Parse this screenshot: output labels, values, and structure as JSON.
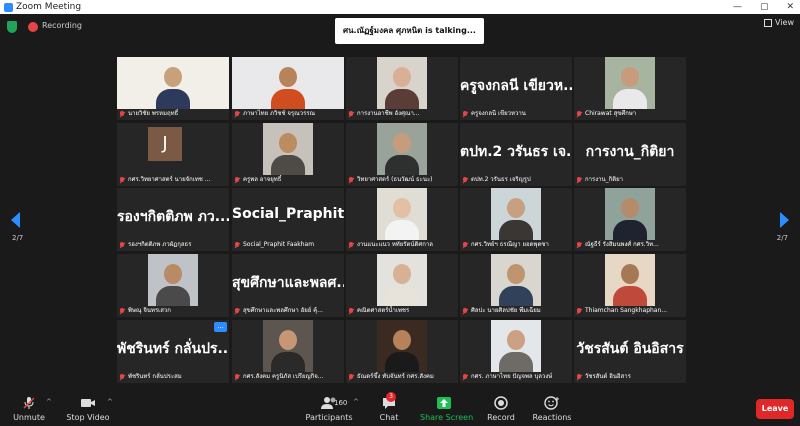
{
  "window": {
    "title": "Zoom Meeting"
  },
  "top": {
    "recording_label": "Recording",
    "talking_text": "ศน.ณัฏฐ์มงคล ศุภหนิต is  talking...",
    "view_label": "View"
  },
  "nav": {
    "page_left": "2/7",
    "page_right": "2/7"
  },
  "tiles": [
    {
      "name": "นายวิชัย  พรหมฤทธิ์",
      "video": true,
      "bg": "#f2efe8",
      "skin": "#c8a07c",
      "shirt": "#2d3a5c"
    },
    {
      "name": "ภาษาไทย ภวิชช์ จรุณวรรณ",
      "video": true,
      "bg": "#e9e9ec",
      "skin": "#b9835a",
      "shirt": "#cf4d1e"
    },
    {
      "name": "การงานอาชีพ อังศุณา...",
      "video": true,
      "bg": "#d8d3cb",
      "skin": "#d9b097",
      "shirt": "#5a3d37"
    },
    {
      "name": "ครูจงกลนี  เขียวหวาน",
      "big": "ครูจงกลนี  เขียวห...",
      "video": false
    },
    {
      "name": "Chirawat สุขศึกษา",
      "video": true,
      "bg": "#a7b4a0",
      "skin": "#c79b7b",
      "shirt": "#e9e9e9"
    },
    {
      "name": "กศร.วิทยาศาสตร์ นายจักเทช ...",
      "video": false,
      "avatar": "J"
    },
    {
      "name": "ครูพล  อาจยุทธิ์",
      "video": true,
      "bg": "#c6c1bb",
      "skin": "#bb8b62",
      "shirt": "#4e4b46"
    },
    {
      "name": "วิทยาศาสตร์ (ธนวัฒน์ ธะนะ)",
      "video": true,
      "bg": "#9aa39a",
      "skin": "#c69d7c",
      "shirt": "#2e2f2f"
    },
    {
      "name": "ตปท.2  วรันธร  เจริญรูป",
      "big": "ตปท.2 วรันธร เจ...",
      "video": false
    },
    {
      "name": "การงาน_กิติยา",
      "big": "การงาน_กิติยา",
      "video": false
    },
    {
      "name": "รองฯกิตติภพ  ภวผัฏกุลธร",
      "big": "รองฯกิตติภพ ภว...",
      "video": false
    },
    {
      "name": "Social_Praphit  Faakham",
      "big": "Social_Praphit F...",
      "video": false
    },
    {
      "name": "งานแนะแนว หทัยรัตน์ดิศกาล",
      "video": true,
      "bg": "#e0ddd5",
      "skin": "#e2bfa5",
      "shirt": "#f3f3f3"
    },
    {
      "name": "กศร.วิทย์ฯ  ธรณีญา ยอดพุดซา",
      "video": true,
      "bg": "#ccd6d8",
      "skin": "#c6a080",
      "shirt": "#3a3634"
    },
    {
      "name": "ณัฐธีร์  รังสิมนพงศ์   กศร.วิท...",
      "video": true,
      "bg": "#8fa39b",
      "skin": "#b48c6c",
      "shirt": "#1f2330"
    },
    {
      "name": "พิษณุ จินทรเสวก",
      "video": true,
      "bg": "#bfc3c7",
      "skin": "#b98a66",
      "shirt": "#4a4a4a"
    },
    {
      "name": "สุขศึกษาและพลศึกษา อัยย์ คุ้...",
      "big": "สุขศึกษาและพลศ...",
      "video": false
    },
    {
      "name": "คณิตศาสตร์น้ำเพชร",
      "video": true,
      "bg": "#e4e2dc",
      "skin": "#d7b096",
      "shirt": "#e7e2da"
    },
    {
      "name": "ศิลปะ นายศิลปชัย พึ่มเฉียม",
      "video": true,
      "bg": "#d9d6cf",
      "skin": "#c0946f",
      "shirt": "#32415a"
    },
    {
      "name": "Thiamchan Sangkhaphan...",
      "video": true,
      "bg": "#e6d8c4",
      "skin": "#a77856",
      "shirt": "#c04a3a"
    },
    {
      "name": "พัชรินทร์ กลั่นประสม",
      "big": "พัชรินทร์ กลั่นปร...",
      "video": false,
      "more": "..."
    },
    {
      "name": "กศร.สังคม ครูนิภัส เปรียญกิจ...",
      "video": true,
      "bg": "#5d5550",
      "skin": "#c79775",
      "shirt": "#2a2a2a"
    },
    {
      "name": "ธัณดร์ขึ้ง ทับจันทร์ กศร.สังคม",
      "video": true,
      "bg": "#3a2a22",
      "skin": "#b5825a",
      "shirt": "#1a1a1a"
    },
    {
      "name": "กศร. ภาษาไทย ปัญจพล บุลวงษ์",
      "video": true,
      "bg": "#e4e7ea",
      "skin": "#cba083",
      "shirt": "#6e6a66"
    },
    {
      "name": "วัชรสันต์ อินอิสาร",
      "big": "วัชรสันต์ อินอิสาร",
      "video": false
    }
  ],
  "toolbar": {
    "unmute": "Unmute",
    "stop_video": "Stop Video",
    "participants": "Participants",
    "participants_count": "160",
    "chat": "Chat",
    "chat_badge": "3",
    "share": "Share Screen",
    "record": "Record",
    "reactions": "Reactions",
    "leave": "Leave"
  },
  "colors": {
    "accent": "#2d8cff",
    "share_green": "#1fbf55",
    "leave_red": "#e02828"
  }
}
